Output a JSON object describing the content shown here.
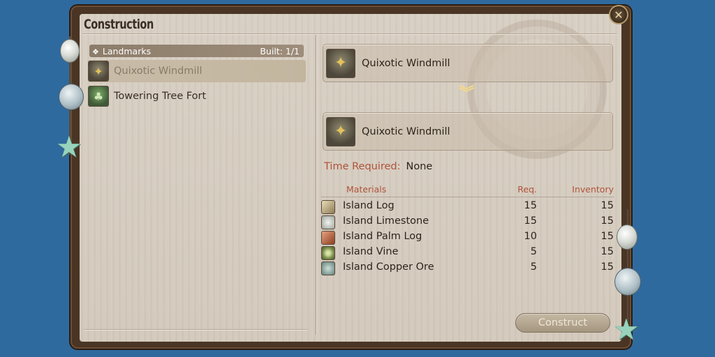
{
  "window": {
    "title": "Construction",
    "close_icon": "close-icon"
  },
  "left_panel": {
    "category": {
      "label": "Landmarks",
      "built": "Built: 1/1"
    },
    "items": [
      {
        "label": "Quixotic Windmill",
        "icon": "windmill-icon",
        "selected": true
      },
      {
        "label": "Towering Tree Fort",
        "icon": "tree-fort-icon",
        "selected": false
      }
    ]
  },
  "right_panel": {
    "current": {
      "label": "Quixotic Windmill",
      "icon": "windmill-icon"
    },
    "result": {
      "label": "Quixotic Windmill",
      "icon": "windmill-icon"
    },
    "time_label": "Time Required:",
    "time_value": "None",
    "materials_header": {
      "name": "Materials",
      "req": "Req.",
      "inventory": "Inventory"
    },
    "materials": [
      {
        "name": "Island Log",
        "req": "15",
        "inventory": "15",
        "icon": "log-icon",
        "color": "#c9b98f"
      },
      {
        "name": "Island Limestone",
        "req": "15",
        "inventory": "15",
        "icon": "limestone-icon",
        "color": "#d7dad4"
      },
      {
        "name": "Island Palm Log",
        "req": "10",
        "inventory": "15",
        "icon": "palm-log-icon",
        "color": "#c56a4a"
      },
      {
        "name": "Island Vine",
        "req": "5",
        "inventory": "15",
        "icon": "vine-icon",
        "color": "#8fae5f"
      },
      {
        "name": "Island Copper Ore",
        "req": "5",
        "inventory": "15",
        "icon": "copper-ore-icon",
        "color": "#7fa09a"
      }
    ],
    "construct_label": "Construct"
  }
}
